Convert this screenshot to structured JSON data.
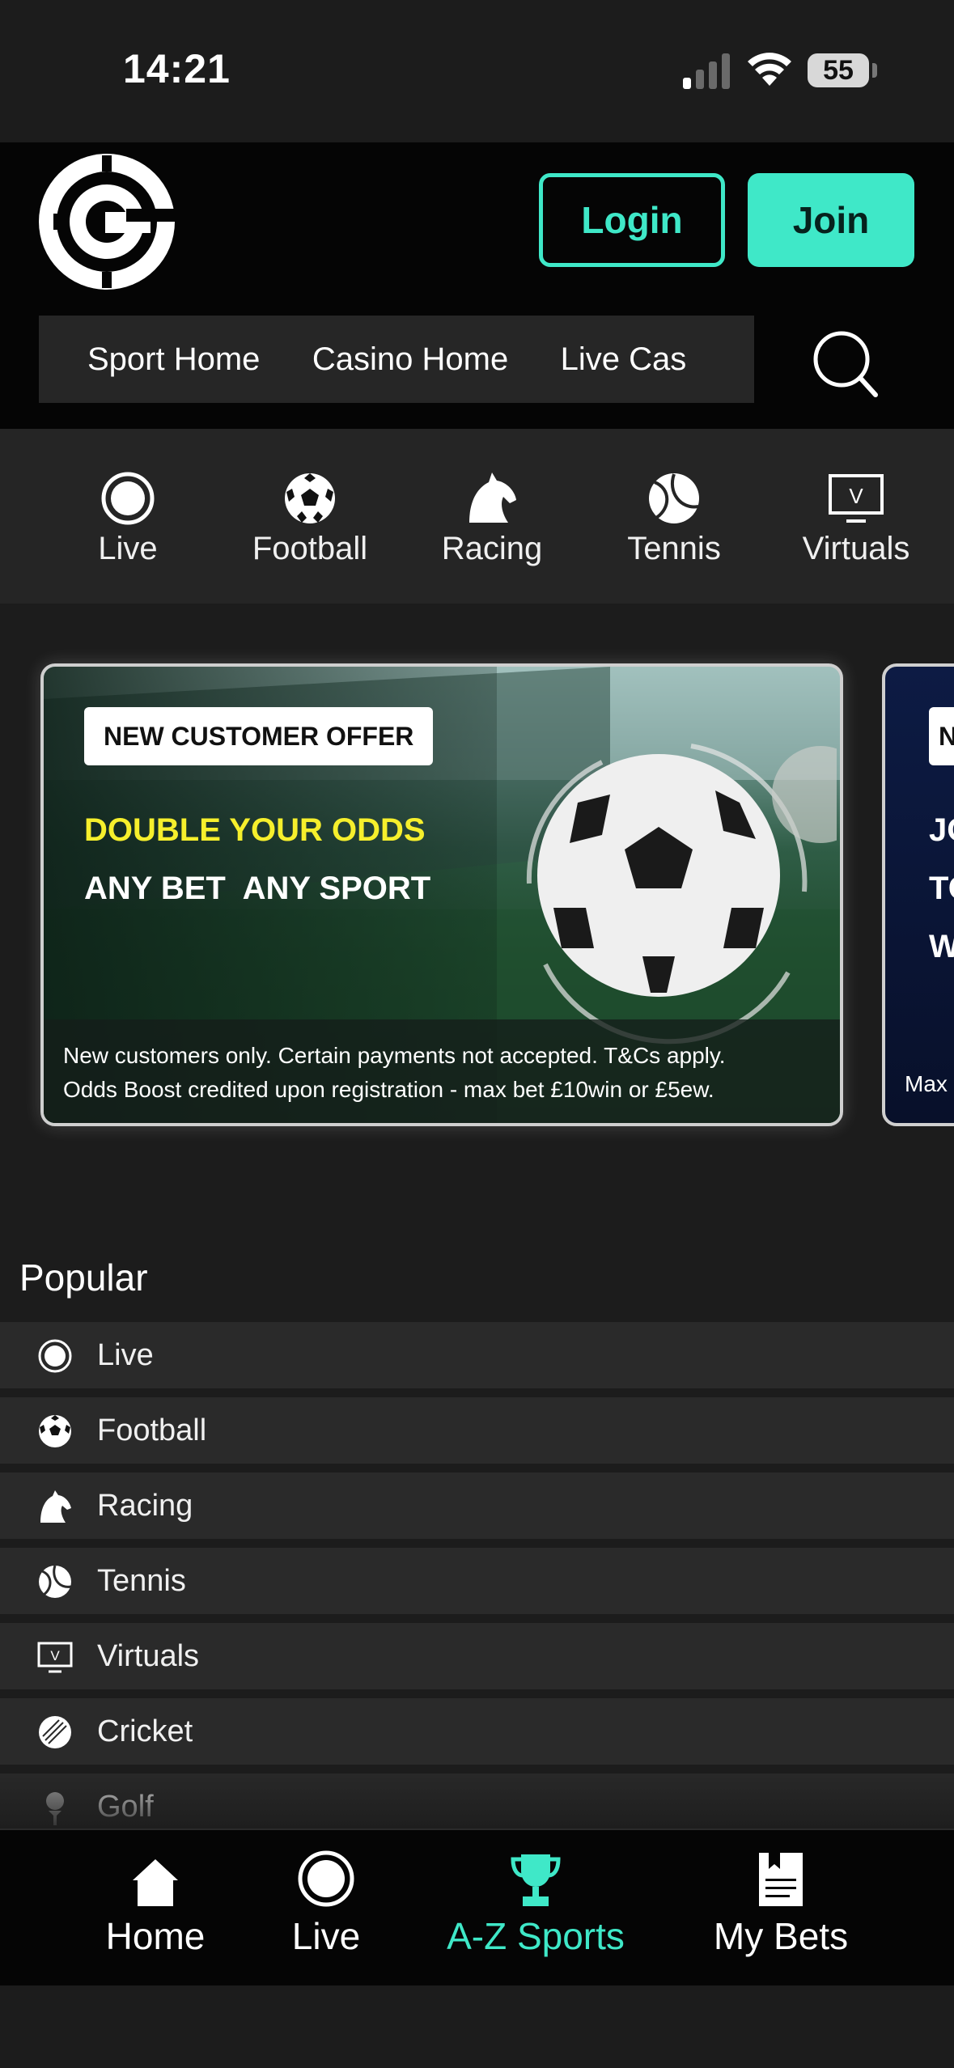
{
  "status_bar": {
    "time": "14:21",
    "battery": "55"
  },
  "header": {
    "login_label": "Login",
    "join_label": "Join",
    "nav_items": [
      "Sport Home",
      "Casino Home",
      "Live Cas"
    ]
  },
  "sports_bar": [
    {
      "label": "Live",
      "icon": "live-icon"
    },
    {
      "label": "Football",
      "icon": "football-icon"
    },
    {
      "label": "Racing",
      "icon": "horse-icon"
    },
    {
      "label": "Tennis",
      "icon": "tennis-ball-icon"
    },
    {
      "label": "Virtuals",
      "icon": "tv-virtuals-icon"
    }
  ],
  "banner": {
    "tag": "NEW CUSTOMER OFFER",
    "line1": "DOUBLE YOUR ODDS",
    "line2": "ANY BET  ANY SPORT",
    "disclaimer_line1": "New customers only. Certain payments not accepted. T&Cs apply.",
    "disclaimer_line2": "Odds Boost credited upon registration - max bet £10win or £5ew.",
    "colors": {
      "headline_yellow": "#f6ef2c"
    }
  },
  "banner_next": {
    "tag": "N",
    "lines": [
      "JO",
      "TO",
      "W"
    ],
    "disclaimer": "Max"
  },
  "popular": {
    "title": "Popular",
    "items": [
      {
        "label": "Live",
        "icon": "live-icon"
      },
      {
        "label": "Football",
        "icon": "football-icon"
      },
      {
        "label": "Racing",
        "icon": "horse-icon"
      },
      {
        "label": "Tennis",
        "icon": "tennis-ball-icon"
      },
      {
        "label": "Virtuals",
        "icon": "tv-virtuals-icon"
      },
      {
        "label": "Cricket",
        "icon": "cricket-ball-icon"
      },
      {
        "label": "Golf",
        "icon": "golf-tee-icon"
      }
    ]
  },
  "bottom_nav": [
    {
      "label": "Home",
      "icon": "home-icon",
      "active": false
    },
    {
      "label": "Live",
      "icon": "live-icon",
      "active": false
    },
    {
      "label": "A-Z Sports",
      "icon": "trophy-icon",
      "active": true
    },
    {
      "label": "My Bets",
      "icon": "betslip-icon",
      "active": false
    }
  ],
  "theme": {
    "accent": "#3fe8c8",
    "background": "#1c1c1c",
    "header": "#050505"
  }
}
